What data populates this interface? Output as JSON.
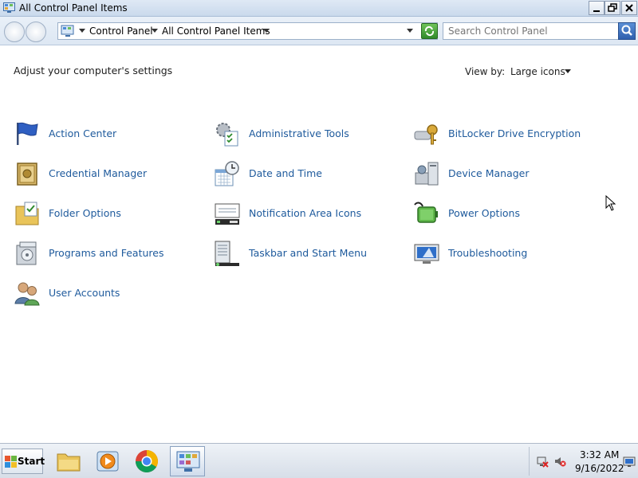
{
  "window": {
    "title": "All Control Panel Items"
  },
  "address": {
    "crumbs": [
      "Control Panel",
      "All Control Panel Items"
    ],
    "search_placeholder": "Search Control Panel"
  },
  "content": {
    "heading": "Adjust your computer's settings",
    "view_by_label": "View by:",
    "view_by_value": "Large icons"
  },
  "items": [
    {
      "label": "Action Center",
      "icon": "flag-icon"
    },
    {
      "label": "Administrative Tools",
      "icon": "admin-tools-icon"
    },
    {
      "label": "BitLocker Drive Encryption",
      "icon": "bitlocker-key-icon"
    },
    {
      "label": "Credential Manager",
      "icon": "vault-icon"
    },
    {
      "label": "Date and Time",
      "icon": "calendar-clock-icon"
    },
    {
      "label": "Device Manager",
      "icon": "device-manager-icon"
    },
    {
      "label": "Folder Options",
      "icon": "folder-options-icon"
    },
    {
      "label": "Notification Area Icons",
      "icon": "notification-area-icon"
    },
    {
      "label": "Power Options",
      "icon": "battery-plug-icon"
    },
    {
      "label": "Programs and Features",
      "icon": "programs-box-icon"
    },
    {
      "label": "Taskbar and Start Menu",
      "icon": "taskbar-icon"
    },
    {
      "label": "Troubleshooting",
      "icon": "troubleshoot-monitor-icon"
    },
    {
      "label": "User Accounts",
      "icon": "users-icon"
    }
  ],
  "taskbar": {
    "start_label": "Start",
    "apps": [
      "explorer-folder-icon",
      "media-player-icon",
      "chrome-icon",
      "control-panel-icon"
    ],
    "time": "3:32 AM",
    "date": "9/16/2022"
  }
}
